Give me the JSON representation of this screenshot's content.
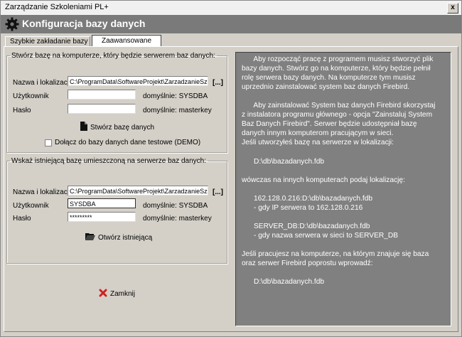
{
  "window": {
    "title": "Zarządzanie Szkoleniami PL+",
    "close_label": "x"
  },
  "header": {
    "title": "Konfiguracja bazy danych",
    "icon": "gear-icon"
  },
  "tabs": [
    {
      "label": "Szybkie zakładanie bazy",
      "active": false
    },
    {
      "label": "Zaawansowane",
      "active": true
    }
  ],
  "create_group": {
    "legend": "Stwórz bazę na komputerze, który będzie serwerem baz danych:",
    "location_label": "Nazwa i lokalizacja",
    "location_value": "C:\\ProgramData\\SoftwareProjekt\\ZarzadzanieSzko",
    "browse_label": "[...]",
    "user_label": "Użytkownik",
    "user_value": "",
    "user_default": "domyślnie:  SYSDBA",
    "password_label": "Hasło",
    "password_value": "",
    "password_default": "domyślnie:  masterkey",
    "create_button": "Stwórz bazę danych",
    "demo_checkbox": "Dołącz do bazy danych dane testowe (DEMO)"
  },
  "open_group": {
    "legend": "Wskaż istniejącą bazę umieszczoną na serwerze baz danych:",
    "location_label": "Nazwa i lokalizacja",
    "location_value": "C:\\ProgramData\\SoftwareProjekt\\ZarzadzanieSzko",
    "browse_label": "[...]",
    "user_label": "Użytkownik",
    "user_value": "SYSDBA",
    "user_default": "domyślnie:  SYSDBA",
    "password_label": "Hasło",
    "password_value": "*********",
    "password_default": "domyślnie:  masterkey",
    "open_button": "Otwórz istniejącą"
  },
  "close_button": "Zamknij",
  "info_lines": [
    "      Aby rozpocząć pracę z programem musisz stworzyć plik",
    "bazy danych. Stwórz go na komputerze, który będzie pełnił",
    "rolę serwera bazy danych. Na komputerze tym musisz",
    "uprzednio zainstalować system baz danych Firebird.",
    "",
    "      Aby zainstalować System baz danych Firebird skorzystaj",
    "z instalatora programu głównego - opcja \"Zainstaluj System",
    "Baz Danych Firebird\". Serwer będzie udostępniał bazę",
    "danych innym komputerom pracującym w sieci.",
    "Jeśli utworzyłeś bazę na serwerze w lokalizacji:",
    "",
    "      D:\\db\\bazadanych.fdb",
    "",
    "wówczas na innych komputerach podaj lokalizację:",
    "",
    "      162.128.0.216:D:\\db\\bazadanych.fdb",
    "      - gdy IP serwera to 162.128.0.216",
    "",
    "      SERVER_DB:D:\\db\\bazadanych.fdb",
    "      - gdy nazwa serwera w sieci to SERVER_DB",
    "",
    "Jeśli pracujesz na komputerze, na którym znajuje się baza",
    "oraz serwer Firebird poprostu wprowadź:",
    "",
    "      D:\\db\\bazadanych.fdb"
  ]
}
